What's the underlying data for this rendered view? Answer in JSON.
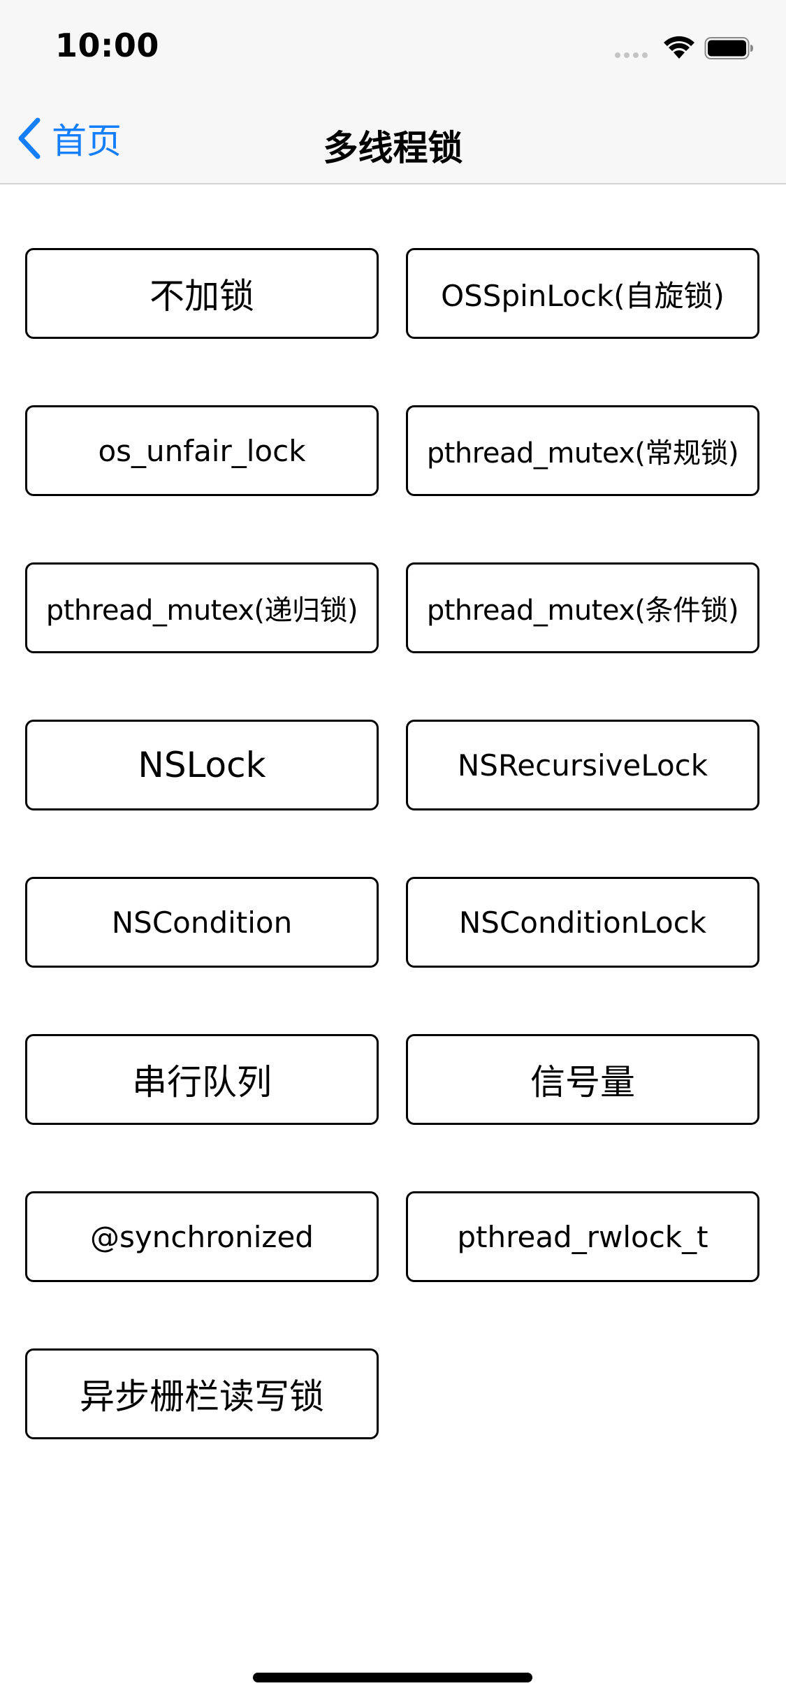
{
  "status_bar": {
    "time": "10:00"
  },
  "nav": {
    "back_label": "首页",
    "title": "多线程锁"
  },
  "colors": {
    "accent": "#157efb",
    "nav_background": "#f7f7f7",
    "button_border": "#000000"
  },
  "buttons": [
    "不加锁",
    "OSSpinLock(自旋锁)",
    "os_unfair_lock",
    "pthread_mutex(常规锁)",
    "pthread_mutex(递归锁)",
    "pthread_mutex(条件锁)",
    "NSLock",
    "NSRecursiveLock",
    "NSCondition",
    "NSConditionLock",
    "串行队列",
    "信号量",
    "@synchronized",
    "pthread_rwlock_t",
    "异步栅栏读写锁"
  ]
}
